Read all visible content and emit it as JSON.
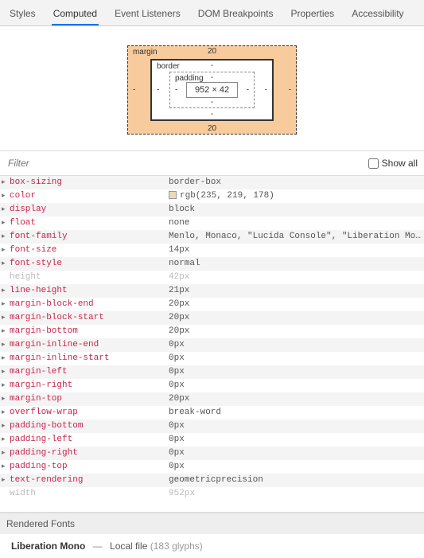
{
  "tabs": {
    "styles": "Styles",
    "computed": "Computed",
    "event_listeners": "Event Listeners",
    "dom_breakpoints": "DOM Breakpoints",
    "properties": "Properties",
    "accessibility": "Accessibility"
  },
  "box_model": {
    "margin_label": "margin",
    "border_label": "border",
    "padding_label": "padding",
    "margin_top": "20",
    "margin_bottom": "20",
    "margin_left": "-",
    "margin_right": "-",
    "border_top": "-",
    "border_bottom": "-",
    "border_left": "-",
    "border_right": "-",
    "padding_top": "-",
    "padding_bottom": "-",
    "padding_left": "-",
    "padding_right": "-",
    "content": "952 × 42"
  },
  "filter": {
    "placeholder": "Filter",
    "showall_label": "Show all"
  },
  "props": [
    {
      "name": "box-sizing",
      "val": "border-box",
      "expand": true
    },
    {
      "name": "color",
      "val": "rgb(235, 219, 178)",
      "expand": true,
      "swatch": true
    },
    {
      "name": "display",
      "val": "block",
      "expand": true
    },
    {
      "name": "float",
      "val": "none",
      "expand": true
    },
    {
      "name": "font-family",
      "val": "Menlo, Monaco, \"Lucida Console\", \"Liberation Mono\",…",
      "expand": true
    },
    {
      "name": "font-size",
      "val": "14px",
      "expand": true
    },
    {
      "name": "font-style",
      "val": "normal",
      "expand": true
    },
    {
      "name": "height",
      "val": "42px",
      "expand": false,
      "dim": true
    },
    {
      "name": "line-height",
      "val": "21px",
      "expand": true
    },
    {
      "name": "margin-block-end",
      "val": "20px",
      "expand": true
    },
    {
      "name": "margin-block-start",
      "val": "20px",
      "expand": true
    },
    {
      "name": "margin-bottom",
      "val": "20px",
      "expand": true
    },
    {
      "name": "margin-inline-end",
      "val": "0px",
      "expand": true
    },
    {
      "name": "margin-inline-start",
      "val": "0px",
      "expand": true
    },
    {
      "name": "margin-left",
      "val": "0px",
      "expand": true
    },
    {
      "name": "margin-right",
      "val": "0px",
      "expand": true
    },
    {
      "name": "margin-top",
      "val": "20px",
      "expand": true
    },
    {
      "name": "overflow-wrap",
      "val": "break-word",
      "expand": true
    },
    {
      "name": "padding-bottom",
      "val": "0px",
      "expand": true
    },
    {
      "name": "padding-left",
      "val": "0px",
      "expand": true
    },
    {
      "name": "padding-right",
      "val": "0px",
      "expand": true
    },
    {
      "name": "padding-top",
      "val": "0px",
      "expand": true
    },
    {
      "name": "text-rendering",
      "val": "geometricprecision",
      "expand": true
    },
    {
      "name": "width",
      "val": "952px",
      "expand": false,
      "dim": true
    }
  ],
  "rendered_fonts": {
    "header": "Rendered Fonts",
    "name": "Liberation Mono",
    "sep": "—",
    "source": "Local file",
    "glyphs": "(183 glyphs)"
  }
}
